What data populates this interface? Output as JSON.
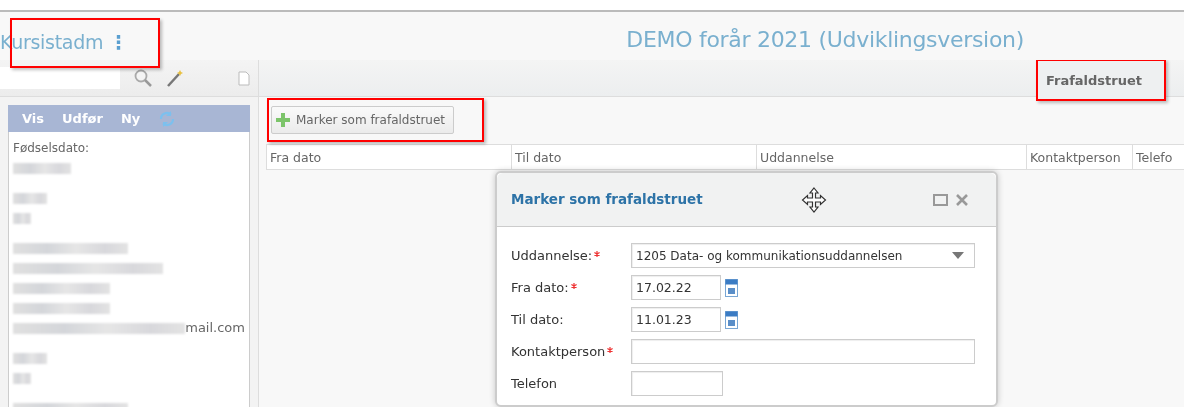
{
  "app": {
    "name": "Kursistadm",
    "menu_glyph": "⋮",
    "environment_title": "DEMO forår 2021 (Udviklingsversion)"
  },
  "sidebar": {
    "menu": [
      {
        "label": "Vis"
      },
      {
        "label": "Udfør"
      },
      {
        "label": "Ny"
      }
    ],
    "details": [
      {
        "kind": "label",
        "text": "Fødselsdato:"
      },
      {
        "kind": "redacted"
      },
      {
        "kind": "gap"
      },
      {
        "kind": "redacted"
      },
      {
        "kind": "redacted"
      },
      {
        "kind": "gap"
      },
      {
        "kind": "redacted"
      },
      {
        "kind": "redacted"
      },
      {
        "kind": "redacted"
      },
      {
        "kind": "redacted"
      },
      {
        "kind": "redacted_suffix",
        "text": "mail.com"
      },
      {
        "kind": "gap"
      },
      {
        "kind": "redacted"
      },
      {
        "kind": "redacted"
      },
      {
        "kind": "gap"
      },
      {
        "kind": "redacted"
      }
    ]
  },
  "tabs": [
    {
      "label": "Frafaldstruet",
      "selected": true,
      "highlighted": true
    }
  ],
  "toolbar": {
    "button": {
      "label": "Marker som frafaldstruet",
      "highlighted": true
    }
  },
  "table": {
    "columns": [
      "Fra dato",
      "Til dato",
      "Uddannelse",
      "Kontaktperson",
      "Telefo"
    ]
  },
  "dialog": {
    "title": "Marker som frafaldstruet",
    "fields": [
      {
        "kind": "select",
        "label": "Uddannelse:",
        "required": true,
        "value": "1205 Data- og kommunikationsuddannelsen"
      },
      {
        "kind": "date",
        "label": "Fra dato:",
        "required": true,
        "value": "17.02.22"
      },
      {
        "kind": "date",
        "label": "Til dato:",
        "required": false,
        "value": "11.01.23"
      },
      {
        "kind": "text",
        "label": "Kontaktperson",
        "required": true
      },
      {
        "kind": "short",
        "label": "Telefon",
        "required": false
      }
    ]
  }
}
